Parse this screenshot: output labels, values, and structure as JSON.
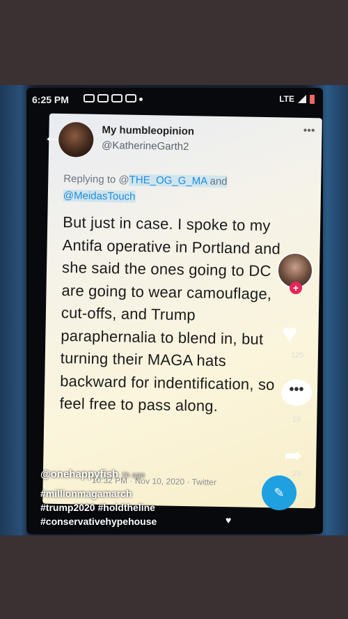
{
  "status_bar": {
    "time": "6:25 PM",
    "network": "LTE",
    "icons": [
      "video-icon",
      "message-icon",
      "sim-icon",
      "p-icon",
      "dot"
    ]
  },
  "tweet": {
    "display_name": "My humbleopinion",
    "handle": "@KatherineGarth2",
    "replying_prefix": "Replying to @",
    "replying_user1": "THE_OG_G_MA",
    "replying_and": " and",
    "replying_user2": "@MeidasTouch",
    "text": "But just in case. I spoke to my Antifa operative in Portland and she said the ones going to DC  are going to wear camouflage, cut-offs, and Trump paraphernalia to blend in, but turning their MAGA hats backward for indentification, so feel free to pass along.",
    "meta": "10:32 PM · Nov 10, 2020 · Twitter"
  },
  "overlay": {
    "user": "@onehappyfish",
    "time_ago": "1h ago",
    "tag_line1": "#millionmagamarch",
    "tag_line2": "#trump2020 #holdtheline",
    "tag_line3": "#conservativehypehouse"
  },
  "actions": {
    "like_count": "125",
    "comment_count": "19",
    "share_count": "23"
  },
  "colors": {
    "background": "#3b3032",
    "mention": "#1d8be0",
    "follow_plus": "#e8245a",
    "fab": "#1fa0e0"
  }
}
